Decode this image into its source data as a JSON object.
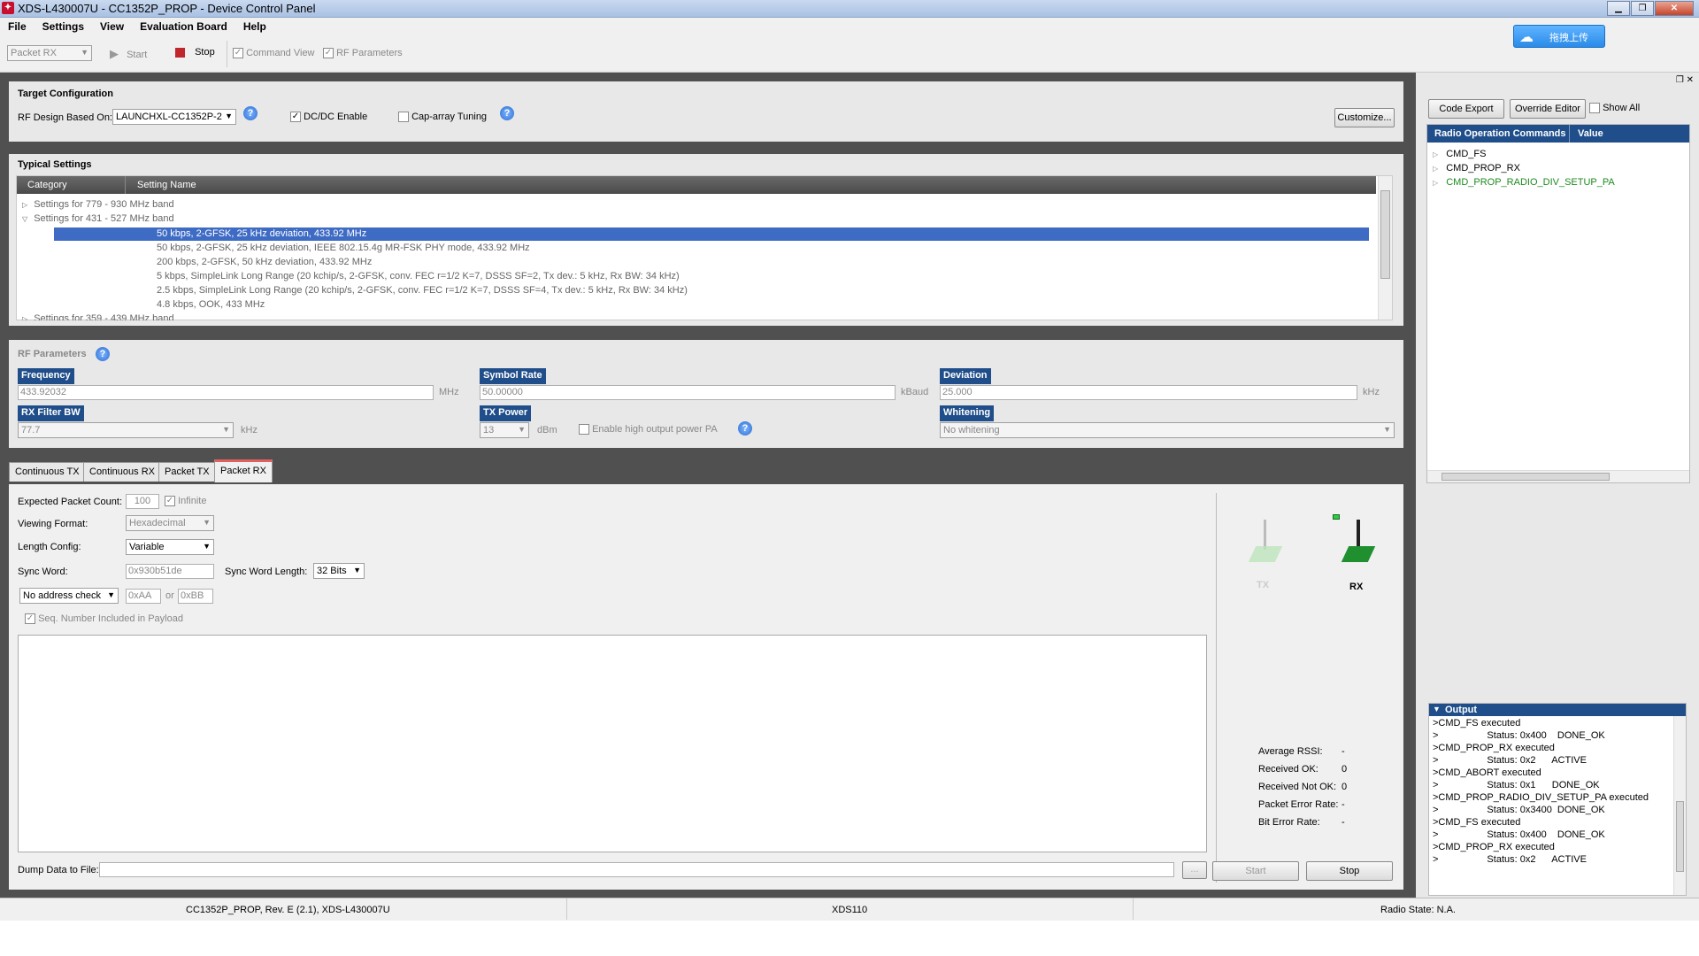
{
  "window": {
    "title": "XDS-L430007U - CC1352P_PROP - Device Control Panel"
  },
  "menu": [
    "File",
    "Settings",
    "View",
    "Evaluation Board",
    "Help"
  ],
  "toolbar": {
    "mode": "Packet RX",
    "start": "Start",
    "stop": "Stop",
    "command_view": "Command View",
    "rf_parameters": "RF Parameters",
    "upload": "拖拽上传"
  },
  "target": {
    "title": "Target Configuration",
    "rf_design_label": "RF Design Based On:",
    "rf_design_value": "LAUNCHXL-CC1352P-2",
    "dcdc": "DC/DC Enable",
    "cap": "Cap-array Tuning",
    "customize": "Customize..."
  },
  "typical": {
    "title": "Typical Settings",
    "col_category": "Category",
    "col_setting": "Setting Name",
    "groups": [
      "Settings for 779 - 930 MHz band",
      "Settings for 431 - 527 MHz band",
      "Settings for 359 - 439 MHz band"
    ],
    "items": [
      "50 kbps, 2-GFSK, 25 kHz deviation, 433.92 MHz",
      "50 kbps, 2-GFSK, 25 kHz deviation, IEEE 802.15.4g MR-FSK PHY mode, 433.92 MHz",
      "200 kbps, 2-GFSK, 50 kHz deviation, 433.92 MHz",
      "5 kbps, SimpleLink Long Range (20 kchip/s, 2-GFSK, conv. FEC r=1/2 K=7, DSSS SF=2, Tx dev.: 5 kHz, Rx BW: 34 kHz)",
      "2.5 kbps, SimpleLink Long Range (20 kchip/s, 2-GFSK, conv. FEC r=1/2 K=7, DSSS SF=4, Tx dev.: 5 kHz, Rx BW: 34 kHz)",
      "4.8 kbps, OOK, 433 MHz"
    ]
  },
  "rf": {
    "title": "RF Parameters",
    "frequency_label": "Frequency",
    "frequency": "433.92032",
    "frequency_unit": "MHz",
    "symbol_label": "Symbol Rate",
    "symbol": "50.00000",
    "symbol_unit": "kBaud",
    "deviation_label": "Deviation",
    "deviation": "25.000",
    "deviation_unit": "kHz",
    "rxbw_label": "RX Filter BW",
    "rxbw": "77.7",
    "rxbw_unit": "kHz",
    "txpower_label": "TX Power",
    "txpower": "13",
    "txpower_unit": "dBm",
    "highpa": "Enable high output power PA",
    "whitening_label": "Whitening",
    "whitening": "No whitening"
  },
  "tabs": [
    "Continuous TX",
    "Continuous RX",
    "Packet TX",
    "Packet RX"
  ],
  "packet_rx": {
    "expected_label": "Expected Packet Count:",
    "expected": "100",
    "infinite": "Infinite",
    "viewing_label": "Viewing Format:",
    "viewing": "Hexadecimal",
    "length_label": "Length Config:",
    "length": "Variable",
    "sync_label": "Sync Word:",
    "sync": "0x930b51de",
    "sync_len_label": "Sync Word Length:",
    "sync_len": "32 Bits",
    "addr": "No address check",
    "addr1": "0xAA",
    "or": "or",
    "addr2": "0xBB",
    "seq": "Seq. Number Included in Payload",
    "dump_label": "Dump Data to File:",
    "browse": "...",
    "tx": "TX",
    "rx": "RX",
    "stats": [
      {
        "label": "Average RSSI:",
        "value": "-"
      },
      {
        "label": "Received OK:",
        "value": "0"
      },
      {
        "label": "Received Not OK:",
        "value": "0"
      },
      {
        "label": "Packet Error Rate:",
        "value": "-"
      },
      {
        "label": "Bit Error Rate:",
        "value": "-"
      }
    ],
    "start": "Start",
    "stop": "Stop"
  },
  "right": {
    "code_export": "Code Export",
    "override_editor": "Override Editor",
    "show_all": "Show All",
    "col_cmd": "Radio Operation Commands",
    "col_val": "Value",
    "commands": [
      "CMD_FS",
      "CMD_PROP_RX",
      "CMD_PROP_RADIO_DIV_SETUP_PA"
    ],
    "output_title": "Output",
    "output": [
      ">CMD_FS executed",
      ">                  Status: 0x400    DONE_OK",
      ">CMD_PROP_RX executed",
      ">                  Status: 0x2      ACTIVE",
      ">CMD_ABORT executed",
      ">                  Status: 0x1      DONE_OK",
      ">CMD_PROP_RADIO_DIV_SETUP_PA executed",
      ">                  Status: 0x3400  DONE_OK",
      ">CMD_FS executed",
      ">                  Status: 0x400    DONE_OK",
      ">CMD_PROP_RX executed",
      ">                  Status: 0x2      ACTIVE"
    ]
  },
  "status": {
    "device": "CC1352P_PROP, Rev. E (2.1), XDS-L430007U",
    "probe": "XDS110",
    "radio": "Radio State: N.A."
  }
}
